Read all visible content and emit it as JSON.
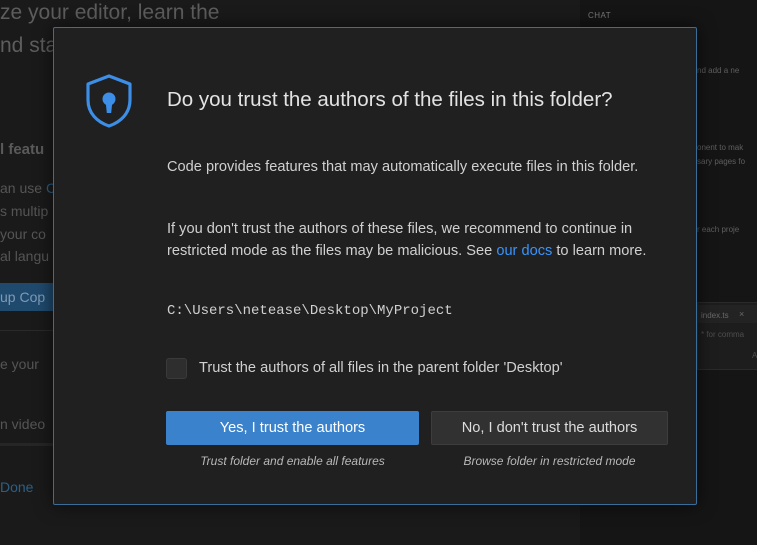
{
  "background": {
    "welcome": {
      "headline_line1": "ze your editor, learn the",
      "headline_line2": "nd sta",
      "feature_heading": "l featu",
      "feature_line1_prefix": "an use ",
      "feature_line1_link": "C",
      "feature_line2": "s multip",
      "feature_line3": " your co",
      "feature_line4": "al langu",
      "setup_button": "up Cop",
      "line_your": "e your",
      "line_video": "n video",
      "done_link": "Done"
    },
    "chat": {
      "title": "CHAT",
      "text1": "nd add a ne",
      "text2": "onent to mak",
      "text3": "sary pages fo",
      "text4": "r each proje",
      "file_tab": "index.ts",
      "file_close": "×",
      "file_hint": "* for comma",
      "file_corner": "A"
    }
  },
  "dialog": {
    "icon": "shield-lock-icon",
    "title": "Do you trust the authors of the files in this folder?",
    "paragraph1": "Code provides features that may automatically execute files in this folder.",
    "paragraph2_before": "If you don't trust the authors of these files, we recommend to continue in restricted mode as the files may be malicious. See ",
    "paragraph2_link": "our docs",
    "paragraph2_after": " to learn more.",
    "folder_path": "C:\\Users\\netease\\Desktop\\MyProject",
    "checkbox_label": "Trust the authors of all files in the parent folder 'Desktop'",
    "checkbox_checked": false,
    "trust_button": "Yes, I trust the authors",
    "trust_subtext": "Trust folder and enable all features",
    "distrust_button": "No, I don't trust the authors",
    "distrust_subtext": "Browse folder in restricted mode"
  },
  "colors": {
    "accent": "#3b82cc",
    "link": "#3794ff",
    "dialog_border": "#3a6d98",
    "dialog_background": "#202020"
  }
}
